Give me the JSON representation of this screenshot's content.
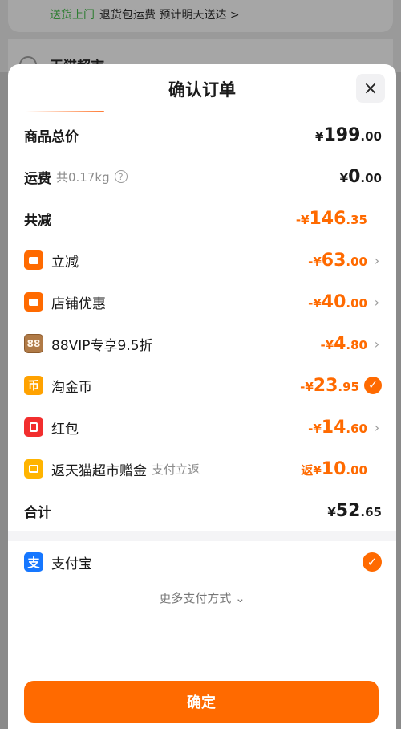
{
  "background": {
    "delivery_tag": "送货上门",
    "delivery_text": "退货包运费  预计明天送达 >",
    "store_name": "天猫超市"
  },
  "sheet": {
    "title": "确认订单",
    "close_label": "×"
  },
  "summary": {
    "total_price": {
      "label": "商品总价",
      "sign": "¥",
      "int": "199",
      "dec": ".00"
    },
    "shipping": {
      "label": "运费",
      "sub": "共0.17kg",
      "help": "?",
      "sign": "¥",
      "int": "0",
      "dec": ".00"
    },
    "total_reduce": {
      "label": "共减",
      "sign": "-¥",
      "int": "146",
      "dec": ".35"
    },
    "discounts": [
      {
        "label": "立减",
        "sub": "",
        "sign": "-¥",
        "int": "63",
        "dec": ".00",
        "action": "chevron",
        "icon": "tag-icon"
      },
      {
        "label": "店铺优惠",
        "sub": "",
        "sign": "-¥",
        "int": "40",
        "dec": ".00",
        "action": "chevron",
        "icon": "shop-coupon-icon"
      },
      {
        "label": "88VIP专享9.5折",
        "sub": "",
        "sign": "-¥",
        "int": "4",
        "dec": ".80",
        "action": "chevron",
        "icon": "vip88-icon",
        "icon_text": "88"
      },
      {
        "label": "淘金币",
        "sub": "",
        "sign": "-¥",
        "int": "23",
        "dec": ".95",
        "action": "check",
        "icon": "coin-icon",
        "icon_text": "币"
      },
      {
        "label": "红包",
        "sub": "",
        "sign": "-¥",
        "int": "14",
        "dec": ".60",
        "action": "chevron",
        "icon": "red-packet-icon"
      },
      {
        "label": "返天猫超市赠金",
        "sub": "支付立返",
        "sign": "返¥",
        "int": "10",
        "dec": ".00",
        "action": "none",
        "icon": "gift-card-icon"
      }
    ],
    "grand_total": {
      "label": "合计",
      "sign": "¥",
      "int": "52",
      "dec": ".65"
    }
  },
  "payment": {
    "method": "支付宝",
    "icon_text": "支",
    "more_label": "更多支付方式"
  },
  "confirm_label": "确定",
  "colors": {
    "accent": "#ff6a00",
    "alipay": "#1677ff"
  }
}
